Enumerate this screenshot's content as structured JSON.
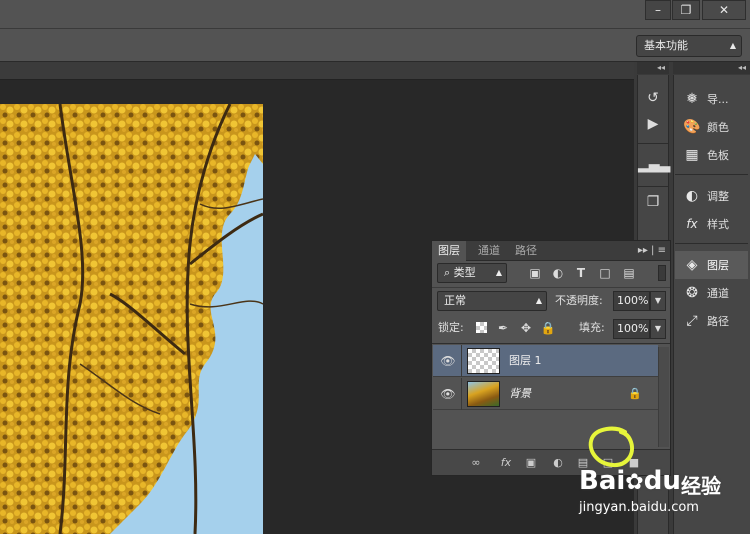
{
  "window": {
    "minimize_label": "–",
    "restore_label": "❐",
    "close_label": "✕",
    "workspace_value": "基本功能"
  },
  "dock_left": {
    "collapse_label": "◂◂",
    "icons": [
      "history-icon",
      "play-icon",
      "histogram-icon",
      "3d-cube-icon"
    ]
  },
  "dock_right": {
    "collapse_label": "◂◂",
    "items": [
      {
        "label": "导...",
        "icon": "navigator-icon"
      },
      {
        "label": "颜色",
        "icon": "color-icon"
      },
      {
        "label": "色板",
        "icon": "swatches-icon"
      },
      {
        "label": "调整",
        "icon": "adjustments-icon"
      },
      {
        "label": "样式",
        "icon": "styles-icon"
      },
      {
        "label": "图层",
        "icon": "layers-icon"
      },
      {
        "label": "通道",
        "icon": "channels-icon"
      },
      {
        "label": "路径",
        "icon": "paths-icon"
      }
    ]
  },
  "layers_panel": {
    "tabs": [
      "图层",
      "通道",
      "路径"
    ],
    "menu_label": "▸▸ | ≡",
    "filter_kind": "⌕ 类型",
    "filter_icons": [
      "image-filter-icon",
      "adjustment-filter-icon",
      "type-filter-icon",
      "shape-filter-icon",
      "smart-object-filter-icon"
    ],
    "blend_mode": "正常",
    "opacity_label": "不透明度:",
    "opacity_value": "100%",
    "lock_label": "锁定:",
    "fill_label": "填充:",
    "fill_value": "100%",
    "layers": [
      {
        "name": "图层 1",
        "selected": true,
        "locked": false
      },
      {
        "name": "背景",
        "selected": false,
        "locked": true
      }
    ],
    "footer_icons": [
      "link-icon",
      "fx-icon",
      "mask-icon",
      "adjustment-icon",
      "group-folder-icon",
      "new-layer-icon",
      "delete-icon"
    ],
    "fx_label": "fx"
  },
  "watermark": {
    "brand": "Bai",
    "brand_tail": "du",
    "cn": "经验",
    "url": "jingyan.baidu.com"
  }
}
